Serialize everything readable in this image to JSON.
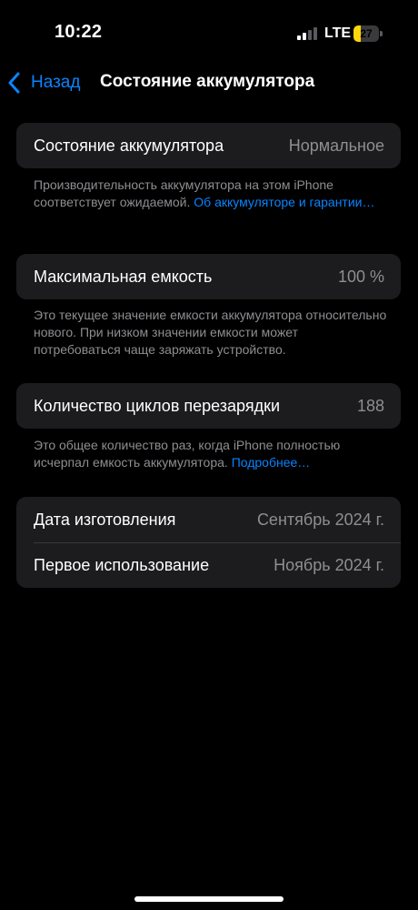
{
  "status_bar": {
    "time": "10:22",
    "network": "LTE",
    "battery_level": "27",
    "battery_fraction": 0.27,
    "battery_color": "#ffd60a",
    "signal_bars_active": 2,
    "signal_bars_total": 4
  },
  "nav": {
    "back_label": "Назад",
    "back_icon": "chevron-left-icon",
    "title": "Состояние аккумулятора"
  },
  "battery_health": {
    "label": "Состояние аккумулятора",
    "value": "Нормальное",
    "footer_text": "Производительность аккумулятора на этом iPhone соответствует ожидаемой. ",
    "footer_link": "Об аккумуляторе и гарантии…"
  },
  "max_capacity": {
    "label": "Максимальная емкость",
    "value": "100 %",
    "footer_text": "Это текущее значение емкости аккумулятора относительно нового. При низком значении емкости может потребоваться чаще заряжать устройство."
  },
  "cycle_count": {
    "label": "Количество циклов перезарядки",
    "value": "188",
    "footer_text": "Это общее количество раз, когда iPhone полностью исчерпал емкость аккумулятора. ",
    "footer_link": "Подробнее…"
  },
  "dates": {
    "manufacture_label": "Дата изготовления",
    "manufacture_value": "Сентябрь 2024 г.",
    "first_use_label": "Первое использование",
    "first_use_value": "Ноябрь 2024 г."
  },
  "colors": {
    "background": "#000000",
    "cell_background": "#1c1c1e",
    "accent": "#0a84ff",
    "secondary_text": "#8e8e93",
    "separator": "#38383a"
  }
}
